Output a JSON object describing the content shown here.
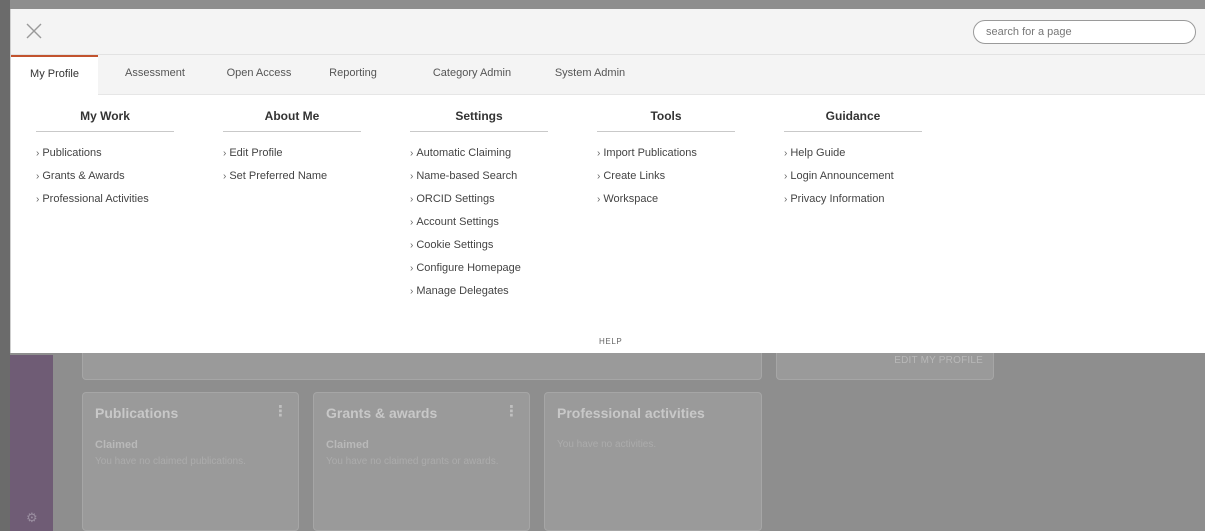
{
  "search": {
    "placeholder": "search for a page"
  },
  "tabs": [
    {
      "label": "My Profile",
      "active": true
    },
    {
      "label": "Assessment"
    },
    {
      "label": "Open Access"
    },
    {
      "label": "Reporting"
    },
    {
      "label": "Category Admin"
    },
    {
      "label": "System Admin"
    }
  ],
  "columns": [
    {
      "heading": "My Work",
      "items": [
        "Publications",
        "Grants & Awards",
        "Professional Activities"
      ]
    },
    {
      "heading": "About Me",
      "items": [
        "Edit Profile",
        "Set Preferred Name"
      ]
    },
    {
      "heading": "Settings",
      "items": [
        "Automatic Claiming",
        "Name-based Search",
        "ORCID Settings",
        "Account Settings",
        "Cookie Settings",
        "Configure Homepage",
        "Manage Delegates"
      ]
    },
    {
      "heading": "Tools",
      "items": [
        "Import Publications",
        "Create Links",
        "Workspace"
      ]
    },
    {
      "heading": "Guidance",
      "items": [
        "Help Guide",
        "Login Announcement",
        "Privacy Information"
      ]
    }
  ],
  "help_label": "HELP",
  "background": {
    "edit_profile": "EDIT MY PROFILE",
    "cards": {
      "publications": {
        "title": "Publications",
        "subtitle": "Claimed",
        "text": "You have no claimed publications."
      },
      "grants": {
        "title": "Grants & awards",
        "subtitle": "Claimed",
        "text": "You have no claimed grants or awards."
      },
      "professional": {
        "title": "Professional activities",
        "text": "You have no activities."
      }
    }
  },
  "colors": {
    "accent": "#c2532e",
    "sidebar": "#6f5c75"
  },
  "icons": {
    "close": "close-icon",
    "kebab": "kebab-icon",
    "chevron": "chevron-right-icon",
    "settings": "settings-icon"
  }
}
